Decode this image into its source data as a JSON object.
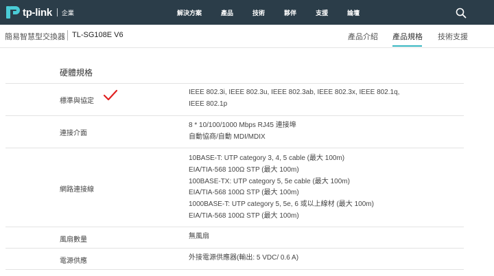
{
  "header": {
    "logo_text": "tp-link",
    "logo_sub": "企業",
    "nav": [
      "解決方案",
      "產品",
      "技術",
      "夥伴",
      "支援",
      "論壇"
    ]
  },
  "subheader": {
    "category": "簡易智慧型交換器",
    "model": "TL-SG108E V6",
    "tabs": [
      "產品介紹",
      "產品規格",
      "技術支援"
    ],
    "active_tab": "產品規格"
  },
  "specs": {
    "section_title": "硬體規格",
    "rows": [
      {
        "label": "標準與協定",
        "lines": [
          "IEEE 802.3i, IEEE 802.3u, IEEE 802.3ab, IEEE 802.3x, IEEE 802.1q,",
          "IEEE 802.1p"
        ]
      },
      {
        "label": "連接介面",
        "lines": [
          "8 * 10/100/1000 Mbps RJ45 連接埠",
          "自動協商/自動 MDI/MDIX"
        ]
      },
      {
        "label": "網路連接線",
        "lines": [
          "10BASE-T: UTP category 3, 4, 5 cable (最大 100m)",
          "EIA/TIA-568 100Ω STP (最大 100m)",
          "100BASE-TX: UTP category 5, 5e cable (最大 100m)",
          "EIA/TIA-568 100Ω STP (最大 100m)",
          "1000BASE-T: UTP category 5, 5e, 6 或以上線材 (最大 100m)",
          "EIA/TIA-568 100Ω STP (最大 100m)"
        ]
      },
      {
        "label": "風扇數量",
        "lines": [
          "無風扇"
        ]
      },
      {
        "label": "電源供應",
        "lines": [
          "外接電源供應器(輸出: 5 VDC/ 0.6 A)"
        ]
      }
    ]
  },
  "colors": {
    "nav_bg": "#2b3d49",
    "accent": "#36b5c0",
    "check": "#e02020"
  },
  "icons": {
    "search": "search-icon",
    "logo": "tp-link-logo-icon",
    "check": "checkmark-icon"
  }
}
